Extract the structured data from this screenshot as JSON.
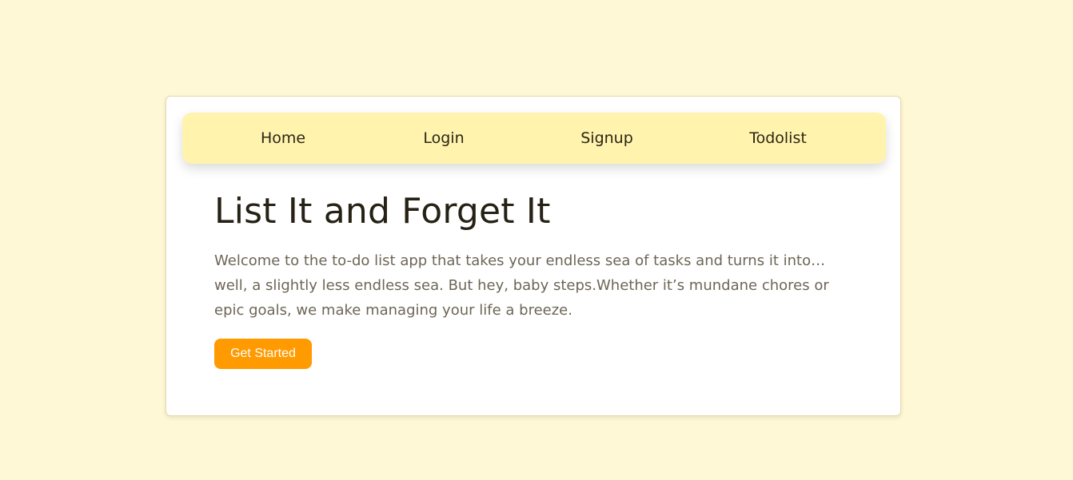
{
  "nav": {
    "home": "Home",
    "login": "Login",
    "signup": "Signup",
    "todolist": "Todolist"
  },
  "hero": {
    "title": "List It and Forget It",
    "description": "Welcome to the to-do list app that takes your endless sea of tasks and turns it into… well, a slightly less endless sea. But hey, baby steps.Whether it’s mundane chores or epic goals, we make managing your life a breeze.",
    "cta_label": "Get Started"
  },
  "colors": {
    "page_background": "#fff8d6",
    "navbar_background": "#fff3ad",
    "cta_background": "#ff9a00",
    "title_text": "#262115",
    "body_text": "#6d6656"
  }
}
